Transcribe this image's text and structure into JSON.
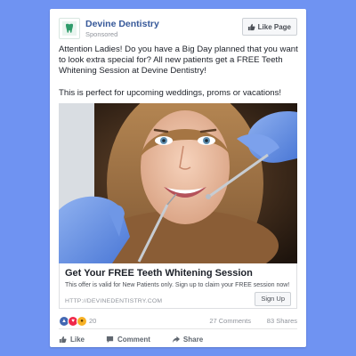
{
  "page": {
    "name": "Devine Dentistry",
    "sponsored": "Sponsored",
    "like_page_label": "Like Page"
  },
  "post": {
    "paragraphs": [
      "Attention Ladies! Do you have a Big Day planned that you want to look extra special for? All new patients get a FREE Teeth Whitening Session at Devine Dentistry!",
      "This is perfect for upcoming weddings, proms or vacations!"
    ]
  },
  "link": {
    "title": "Get Your FREE Teeth Whitening Session",
    "description": "This offer is valid for New Patients only. Sign up to claim your FREE session now!",
    "url": "HTTP://DEVINEDENTISTRY.COM",
    "cta": "Sign Up"
  },
  "stats": {
    "reactions": "20",
    "comments": "27 Comments",
    "shares": "83 Shares"
  },
  "actions": {
    "like": "Like",
    "comment": "Comment",
    "share": "Share"
  },
  "colors": {
    "background": "#6f93f2",
    "link": "#365899",
    "logo_green": "#2e9b6a"
  }
}
